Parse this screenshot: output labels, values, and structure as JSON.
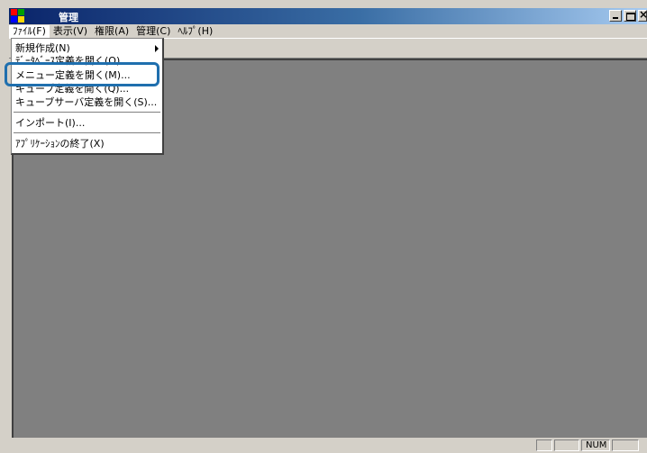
{
  "window": {
    "title": "管理",
    "min_label": "_",
    "max_label": "□",
    "close_label": "×"
  },
  "menubar": {
    "items": [
      {
        "label": "ﾌｧｲﾙ(F)"
      },
      {
        "label": "表示(V)"
      },
      {
        "label": "権限(A)"
      },
      {
        "label": "管理(C)"
      },
      {
        "label": "ﾍﾙﾌﾟ(H)"
      }
    ]
  },
  "file_menu": {
    "items": [
      {
        "label": "新規作成(N)"
      },
      {
        "label": "ﾃﾞｰﾀﾍﾞｰｽ定義を開く(O)..."
      },
      {
        "label": "メニュー定義を開く(M)..."
      },
      {
        "label": "キューブ定義を開く(Q)..."
      },
      {
        "label": "キューブサーバ定義を開く(S)..."
      },
      {
        "label": "インポート(I)..."
      },
      {
        "label": "ｱﾌﾟﾘｹｰｼｮﾝの終了(X)"
      }
    ],
    "highlighted": "メニュー定義を開く(M)..."
  },
  "statusbar": {
    "num_label": "NUM"
  },
  "colors": {
    "client_bg": "#808080",
    "highlight_outline": "#1f6fae",
    "titlebar_start": "#0a246a"
  }
}
